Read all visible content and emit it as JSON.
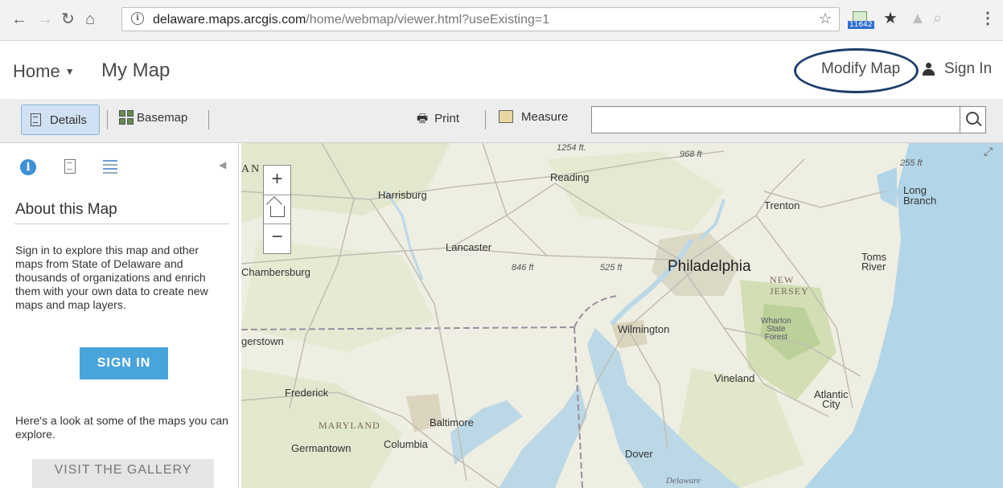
{
  "browser": {
    "url_host": "delaware.maps.arcgis.com",
    "url_path": "/home/webmap/viewer.html?useExisting=1",
    "extension_badge": "11642"
  },
  "header": {
    "home_label": "Home",
    "map_title": "My Map",
    "modify_map_label": "Modify Map",
    "sign_in_label": "Sign In"
  },
  "toolbar": {
    "details_label": "Details",
    "basemap_label": "Basemap",
    "print_label": "Print",
    "measure_label": "Measure",
    "search_value": ""
  },
  "side_panel": {
    "about_title": "About this Map",
    "about_text": "Sign in to explore this map and other maps from State of Delaware and thousands of organizations and enrich them with your own data to create new maps and map layers.",
    "sign_in_button": "SIGN IN",
    "gallery_text": "Here's a look at some of the maps you can explore.",
    "gallery_button": "VISIT THE GALLERY"
  },
  "map": {
    "labels": {
      "reading": "Reading",
      "harrisburg": "Harrisburg",
      "trenton": "Trenton",
      "long_branch": "Long\nBranch",
      "lancaster": "Lancaster",
      "chambersburg": "Chambersburg",
      "philadelphia": "Philadelphia",
      "toms_river": "Toms\nRiver",
      "new_jersey": "NEW\nJERSEY",
      "wharton": "Wharton\nState\nForest",
      "wilmington": "Wilmington",
      "hagerstown": "gerstown",
      "vineland": "Vineland",
      "frederick": "Frederick",
      "atlantic_city": "Atlantic\nCity",
      "maryland": "MARYLAND",
      "baltimore": "Baltimore",
      "columbia": "Columbia",
      "germantown": "Germantown",
      "dover": "Dover",
      "delaware_bay": "Delaware",
      "pa_fragment": "AN"
    },
    "elevations": {
      "e1254": "1254 ft.",
      "e968": "968 ft",
      "e255": "255 ft",
      "e846": "846 ft",
      "e525": "525 ft"
    }
  }
}
